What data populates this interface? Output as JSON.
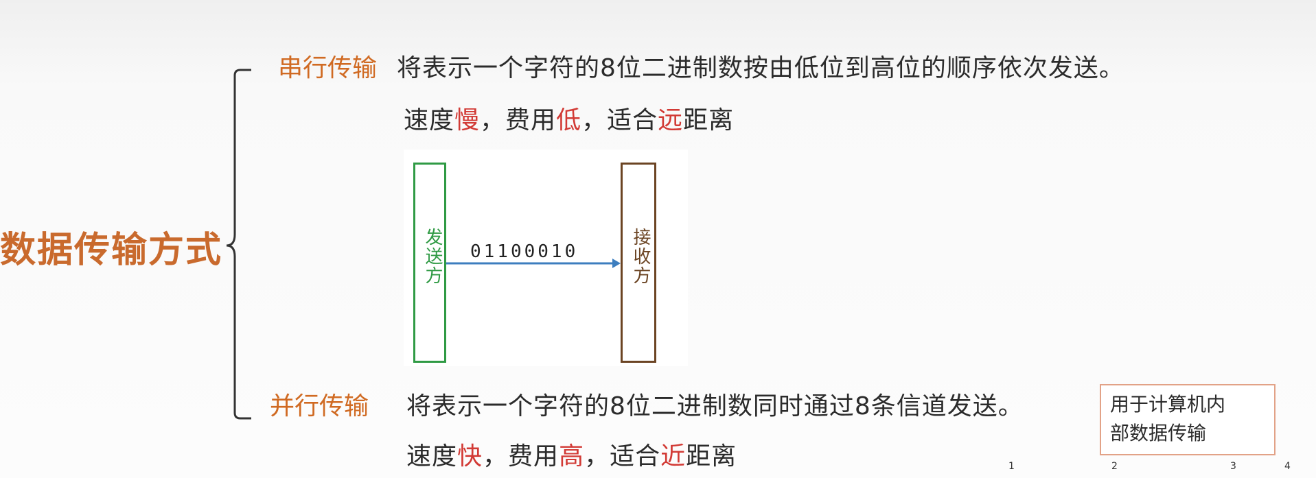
{
  "root": {
    "title": "数据传输方式"
  },
  "serial": {
    "title": "串行传输",
    "description": "将表示一个字符的8位二进制数按由低位到高位的顺序依次发送。",
    "traits": [
      {
        "label": "速度",
        "value": "慢"
      },
      {
        "label": "费用",
        "value": "低"
      },
      {
        "label": "适合",
        "value": "远",
        "suffix": "距离"
      }
    ]
  },
  "diagram": {
    "sender": "发送方",
    "receiver": "接收方",
    "bits": "01100010",
    "colors": {
      "sender": "#2f9a44",
      "receiver": "#6b4423",
      "arrow": "#3d7ebf"
    }
  },
  "parallel": {
    "title": "并行传输",
    "description": "将表示一个字符的8位二进制数同时通过8条信道发送。",
    "traits": [
      {
        "label": "速度",
        "value": "快"
      },
      {
        "label": "费用",
        "value": "高"
      },
      {
        "label": "适合",
        "value": "近",
        "suffix": "距离"
      }
    ]
  },
  "note": {
    "lines": [
      "用于计算机内",
      "部数据传输"
    ]
  },
  "ticks": [
    "1",
    "2",
    "3",
    "4"
  ],
  "colors": {
    "section_title": "#d06a22",
    "root_title": "#c96a2d",
    "highlight": "#d23a35",
    "bracket": "#333333",
    "note_border": "#e2a287"
  }
}
